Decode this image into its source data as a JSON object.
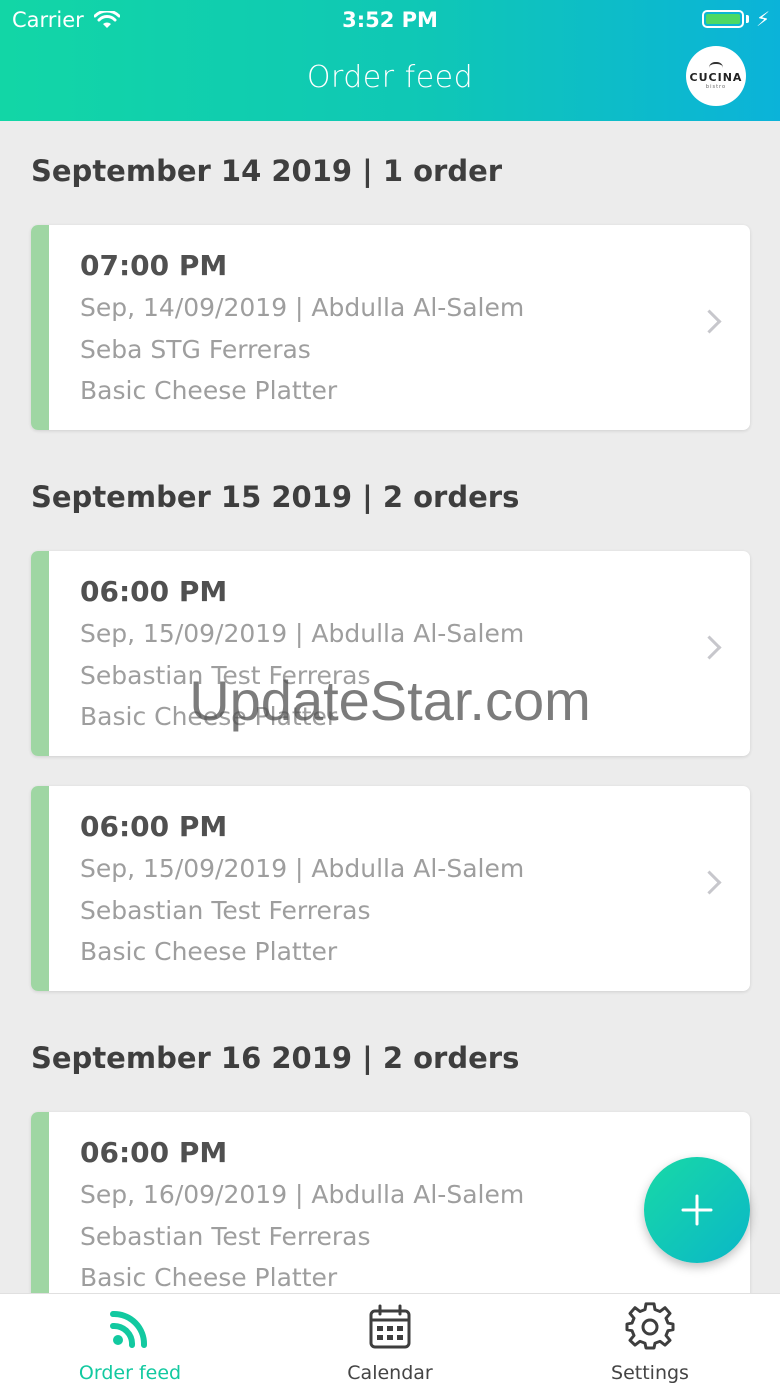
{
  "status_bar": {
    "carrier": "Carrier",
    "time": "3:52 PM"
  },
  "header": {
    "title": "Order feed",
    "logo_text": "CUCINA",
    "logo_sub": "bistro"
  },
  "sections": [
    {
      "title": "September 14 2019 | 1 order",
      "orders": [
        {
          "time": "07:00 PM",
          "date_customer": "Sep, 14/09/2019 | Abdulla Al-Salem",
          "contact": "Seba STG Ferreras",
          "item": "Basic Cheese Platter"
        }
      ]
    },
    {
      "title": "September 15 2019 | 2 orders",
      "orders": [
        {
          "time": "06:00 PM",
          "date_customer": "Sep, 15/09/2019 | Abdulla Al-Salem",
          "contact": "Sebastian Test Ferreras",
          "item": "Basic Cheese Platter"
        },
        {
          "time": "06:00 PM",
          "date_customer": "Sep, 15/09/2019 | Abdulla Al-Salem",
          "contact": "Sebastian Test Ferreras",
          "item": "Basic Cheese Platter"
        }
      ]
    },
    {
      "title": "September 16 2019 | 2 orders",
      "orders": [
        {
          "time": "06:00 PM",
          "date_customer": "Sep, 16/09/2019 | Abdulla Al-Salem",
          "contact": "Sebastian Test Ferreras",
          "item": "Basic Cheese Platter"
        }
      ]
    }
  ],
  "watermark": "UpdateStar.com",
  "fab": {
    "icon": "plus-icon"
  },
  "tabs": [
    {
      "label": "Order feed",
      "icon": "feed-icon",
      "active": true
    },
    {
      "label": "Calendar",
      "icon": "calendar-icon",
      "active": false
    },
    {
      "label": "Settings",
      "icon": "gear-icon",
      "active": false
    }
  ],
  "colors": {
    "accent": "#12c9a0",
    "card_accent": "#9fd6a3",
    "header_start": "#12d6a6",
    "header_end": "#0bb3d9"
  }
}
